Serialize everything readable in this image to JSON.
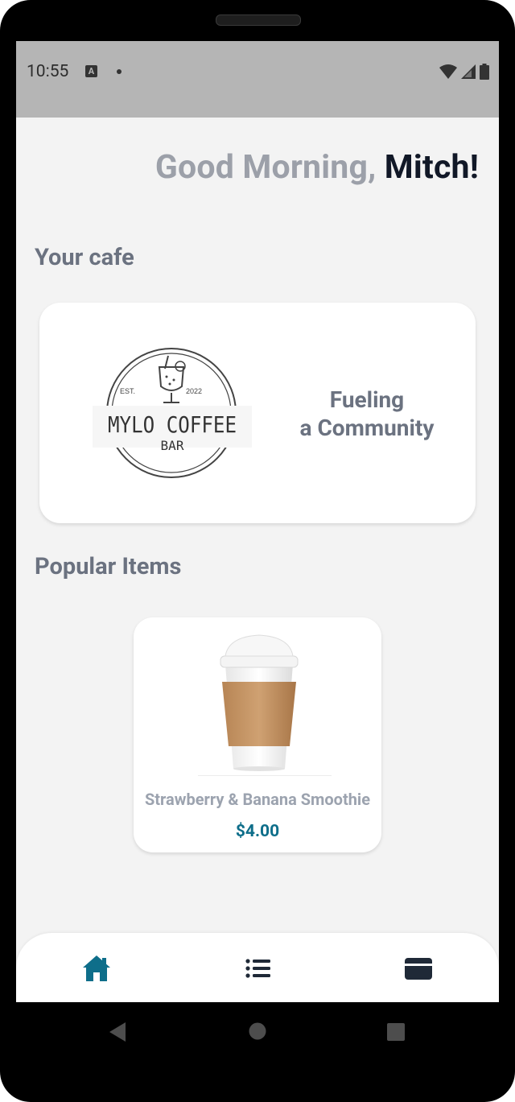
{
  "status_bar": {
    "time": "10:55",
    "notification_icon_letter": "A"
  },
  "greeting": {
    "prefix": "Good Morning,",
    "name": "Mitch!"
  },
  "cafe_section": {
    "title": "Your cafe",
    "logo": {
      "est": "EST.",
      "year": "2022",
      "name": "MYLO COFFEE",
      "sub": "BAR"
    },
    "tagline_line1": "Fueling",
    "tagline_line2": "a Community"
  },
  "popular_section": {
    "title": "Popular Items",
    "items": [
      {
        "name": "Strawberry & Banana Smoothie",
        "price": "$4.00",
        "image_icon": "coffee-cup-image"
      }
    ]
  },
  "bottom_nav": [
    {
      "icon": "home-icon",
      "active": true
    },
    {
      "icon": "list-icon",
      "active": false
    },
    {
      "icon": "card-icon",
      "active": false
    }
  ],
  "colors": {
    "accent": "#0e6e8a",
    "greeting_gray": "#9ca0a9",
    "name_dark": "#111827",
    "heading_gray": "#6b7280"
  }
}
